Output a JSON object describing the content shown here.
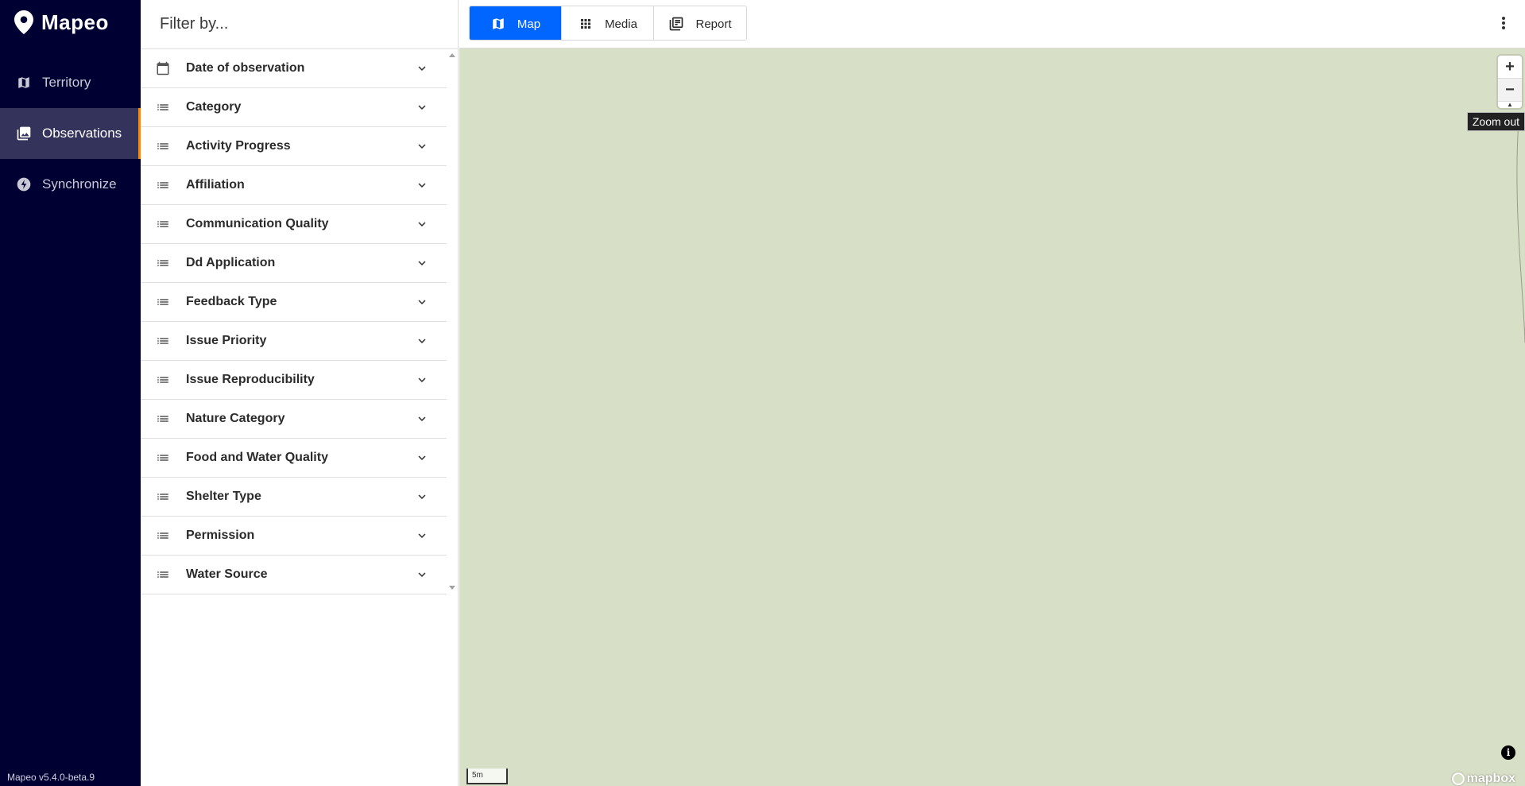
{
  "app": {
    "name": "Mapeo",
    "version": "Mapeo v5.4.0-beta.9"
  },
  "nav": {
    "items": [
      {
        "label": "Territory",
        "icon": "map-icon",
        "active": false
      },
      {
        "label": "Observations",
        "icon": "photo-library-icon",
        "active": true
      },
      {
        "label": "Synchronize",
        "icon": "flash-icon",
        "active": false
      }
    ]
  },
  "filter": {
    "placeholder": "Filter by...",
    "items": [
      {
        "label": "Date of observation",
        "icon": "calendar-icon"
      },
      {
        "label": "Category",
        "icon": "list-icon"
      },
      {
        "label": "Activity Progress",
        "icon": "list-icon"
      },
      {
        "label": "Affiliation",
        "icon": "list-icon"
      },
      {
        "label": "Communication Quality",
        "icon": "list-icon"
      },
      {
        "label": "Dd Application",
        "icon": "list-icon"
      },
      {
        "label": "Feedback Type",
        "icon": "list-icon"
      },
      {
        "label": "Issue Priority",
        "icon": "list-icon"
      },
      {
        "label": "Issue Reproducibility",
        "icon": "list-icon"
      },
      {
        "label": "Nature Category",
        "icon": "list-icon"
      },
      {
        "label": "Food and Water Quality",
        "icon": "list-icon"
      },
      {
        "label": "Shelter Type",
        "icon": "list-icon"
      },
      {
        "label": "Permission",
        "icon": "list-icon"
      },
      {
        "label": "Water Source",
        "icon": "list-icon"
      }
    ]
  },
  "view_tabs": [
    {
      "label": "Map",
      "icon": "map-icon",
      "active": true
    },
    {
      "label": "Media",
      "icon": "grid-icon",
      "active": false
    },
    {
      "label": "Report",
      "icon": "report-icon",
      "active": false
    }
  ],
  "map": {
    "zoom_in": "+",
    "zoom_out": "−",
    "tooltip": "Zoom out",
    "scale_label": "5m",
    "attribution_logo": "mapbox",
    "background_color": "#d8dfc7"
  },
  "colors": {
    "nav_bg": "#000033",
    "nav_active_bg": "#33335c",
    "nav_active_indicator": "#ff8a00",
    "accent": "#0066ff"
  }
}
